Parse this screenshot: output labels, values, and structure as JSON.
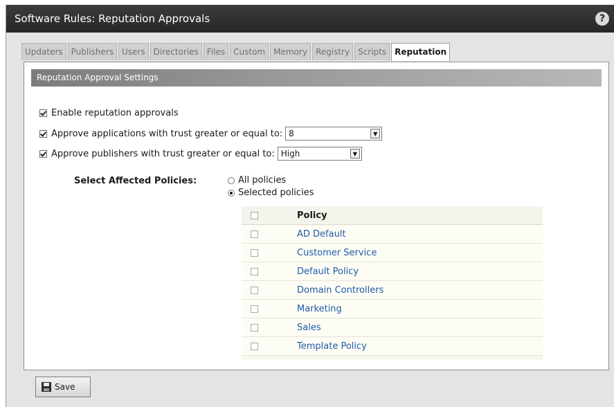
{
  "window": {
    "title": "Software Rules: Reputation Approvals",
    "help_label": "?"
  },
  "tabs": [
    {
      "label": "Updaters",
      "active": false
    },
    {
      "label": "Publishers",
      "active": false
    },
    {
      "label": "Users",
      "active": false
    },
    {
      "label": "Directories",
      "active": false
    },
    {
      "label": "Files",
      "active": false
    },
    {
      "label": "Custom",
      "active": false
    },
    {
      "label": "Memory",
      "active": false
    },
    {
      "label": "Registry",
      "active": false
    },
    {
      "label": "Scripts",
      "active": false
    },
    {
      "label": "Reputation",
      "active": true
    }
  ],
  "settings": {
    "header": "Reputation Approval Settings",
    "enable_label": "Enable reputation approvals",
    "enable_checked": true,
    "apps_label": "Approve applications with trust greater or equal to:",
    "apps_checked": true,
    "apps_value": "8",
    "publishers_label": "Approve publishers with trust greater or equal to:",
    "publishers_checked": true,
    "publishers_value": "High"
  },
  "policies": {
    "section_label": "Select Affected Policies:",
    "radio_all_label": "All policies",
    "radio_selected_label": "Selected policies",
    "selected_mode": "selected",
    "column_header": "Policy",
    "items": [
      {
        "name": "AD Default",
        "checked": false
      },
      {
        "name": "Customer Service",
        "checked": false
      },
      {
        "name": "Default Policy",
        "checked": false
      },
      {
        "name": "Domain Controllers",
        "checked": false
      },
      {
        "name": "Marketing",
        "checked": false
      },
      {
        "name": "Sales",
        "checked": false
      },
      {
        "name": "Template Policy",
        "checked": false
      }
    ]
  },
  "footer": {
    "save_label": "Save"
  },
  "colors": {
    "titlebar": "#2f2f2f",
    "link": "#1f5aa6",
    "panel_border": "#8e8e8e"
  }
}
